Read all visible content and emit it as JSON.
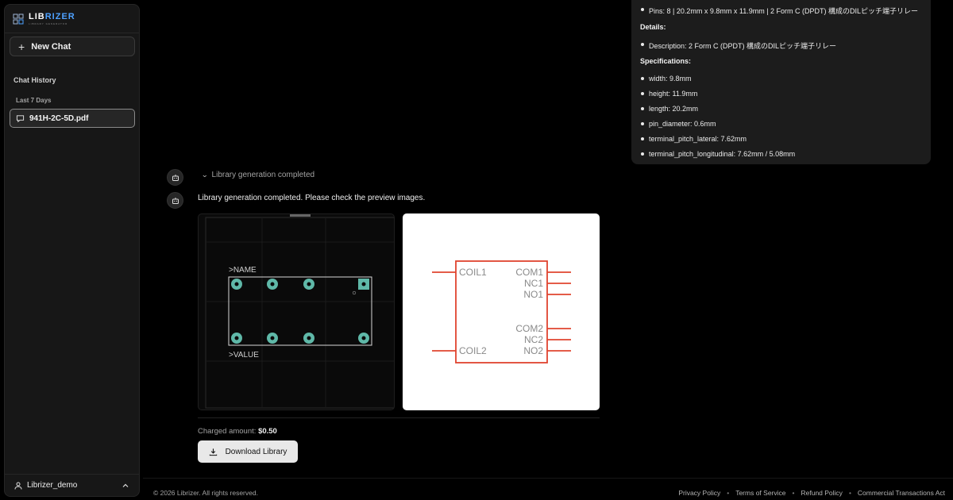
{
  "app": {
    "logo_main": "LIB",
    "logo_accent": "RIZER",
    "logo_sub": "LIBRARY GENERATOR"
  },
  "sidebar": {
    "new_chat_label": "New Chat",
    "history_title": "Chat History",
    "groups": [
      {
        "label": "Last 7 Days",
        "items": [
          {
            "label": "941H-2C-5D.pdf"
          }
        ]
      }
    ],
    "user_name": "Librizer_demo"
  },
  "details_card": {
    "summary_item": "Pins: 8 | 20.2mm x 9.8mm x 11.9mm | 2 Form C (DPDT) 構成のDILピッチ端子リレー",
    "details_heading": "Details:",
    "details_items": [
      "Description: 2 Form C (DPDT) 構成のDILピッチ端子リレー"
    ],
    "specs_heading": "Specifications:",
    "specs_items": [
      "width: 9.8mm",
      "height: 11.9mm",
      "length: 20.2mm",
      "pin_diameter: 0.6mm",
      "terminal_pitch_lateral: 7.62mm",
      "terminal_pitch_longitudinal: 7.62mm / 5.08mm"
    ]
  },
  "chat": {
    "collapse_label": "Library generation completed",
    "message": "Library generation completed. Please check the preview images.",
    "footprint": {
      "name_label": ">NAME",
      "value_label": ">VALUE"
    },
    "symbol": {
      "left_pins": [
        "COIL1",
        "COIL2"
      ],
      "right_pins": [
        "COM1",
        "NC1",
        "NO1",
        "COM2",
        "NC2",
        "NO2"
      ],
      "stroke_color": "#e0442f"
    },
    "charged_label": "Charged amount:",
    "charged_value": "$0.50",
    "download_label": "Download Library"
  },
  "footer": {
    "copyright": "© 2026 Librizer. All rights reserved.",
    "links": [
      "Privacy Policy",
      "Terms of Service",
      "Refund Policy",
      "Commercial Transactions Act"
    ]
  },
  "colors": {
    "accent": "#4ea1ff",
    "pad": "#5fb8a8",
    "symbol": "#e0442f"
  }
}
